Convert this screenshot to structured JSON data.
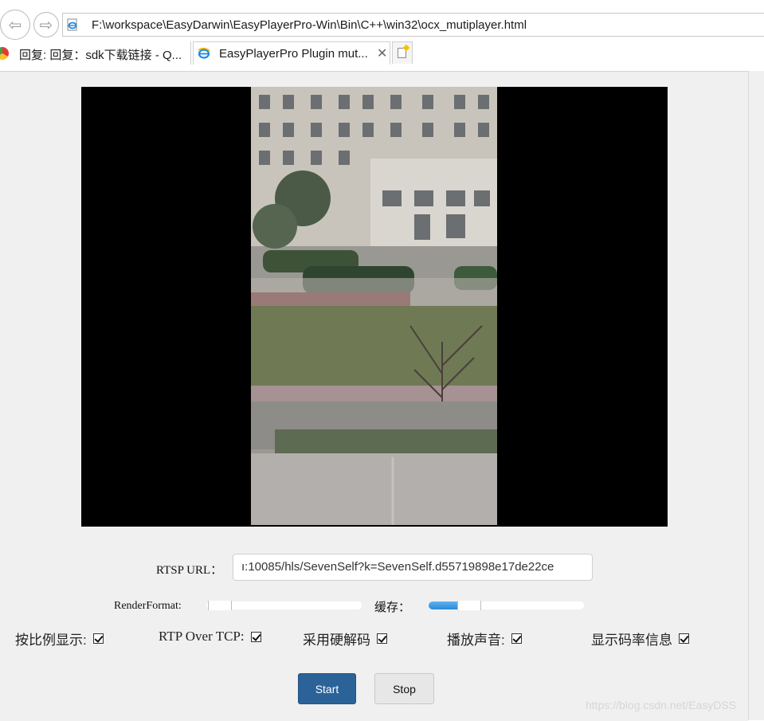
{
  "browser": {
    "address": "F:\\workspace\\EasyDarwin\\EasyPlayerPro-Win\\Bin\\C++\\win32\\ocx_mutiplayer.html",
    "tabs": [
      {
        "label": "回复: 回复：sdk下载链接 - Q..."
      },
      {
        "label": "EasyPlayerPro Plugin mut...",
        "close": "✕"
      }
    ]
  },
  "player": {
    "rtsp_label": "RTSP URL：",
    "rtsp_value": "ı:10085/hls/SevenSelf?k=SevenSelf.d55719898e17de22ce",
    "render_label": "RenderFormat:",
    "cache_label": "缓存：",
    "render_level": 0.0,
    "cache_level": 0.18
  },
  "options": [
    {
      "label": "按比例显示:",
      "checked": true
    },
    {
      "label": "RTP Over TCP:",
      "checked": true
    },
    {
      "label": "采用硬解码",
      "checked": true
    },
    {
      "label": "播放声音:",
      "checked": true
    },
    {
      "label": "显示码率信息",
      "checked": true
    }
  ],
  "buttons": {
    "start": "Start",
    "stop": "Stop"
  },
  "watermark": "https://blog.csdn.net/EasyDSS"
}
